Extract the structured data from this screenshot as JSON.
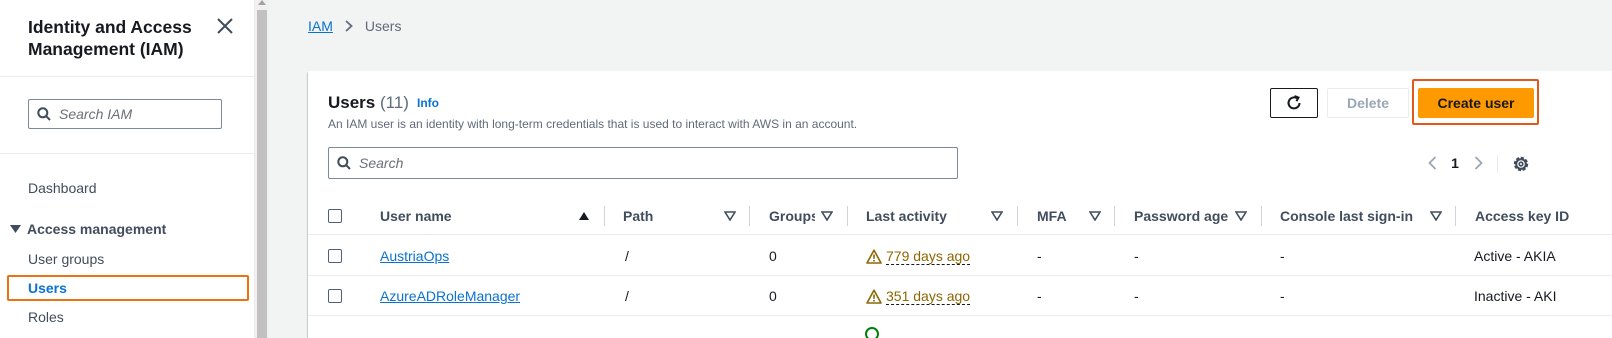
{
  "sidebar": {
    "title": "Identity and Access Management (IAM)",
    "search_placeholder": "Search IAM",
    "dashboard": "Dashboard",
    "section": "Access management",
    "items": [
      "User groups",
      "Users",
      "Roles"
    ]
  },
  "breadcrumb": {
    "root": "IAM",
    "current": "Users"
  },
  "header": {
    "title": "Users",
    "count": "(11)",
    "info": "Info",
    "description": "An IAM user is an identity with long-term credentials that is used to interact with AWS in an account."
  },
  "actions": {
    "delete": "Delete",
    "create": "Create user"
  },
  "table": {
    "search_placeholder": "Search",
    "page": "1",
    "columns": [
      "User name",
      "Path",
      "Groups",
      "Last activity",
      "MFA",
      "Password age",
      "Console last sign-in",
      "Access key ID"
    ],
    "rows": [
      {
        "user": "AustriaOps",
        "path": "/",
        "groups": "0",
        "activity": "779 days ago",
        "mfa": "-",
        "pwd": "-",
        "console": "-",
        "key": "Active - AKIA"
      },
      {
        "user": "AzureADRoleManager",
        "path": "/",
        "groups": "0",
        "activity": "351 days ago",
        "mfa": "-",
        "pwd": "-",
        "console": "-",
        "key": "Inactive - AKI"
      }
    ]
  },
  "colors": {
    "accent": "#ff9900",
    "link": "#0972d3",
    "warning": "#8d6605",
    "focus": "#ec7211"
  }
}
